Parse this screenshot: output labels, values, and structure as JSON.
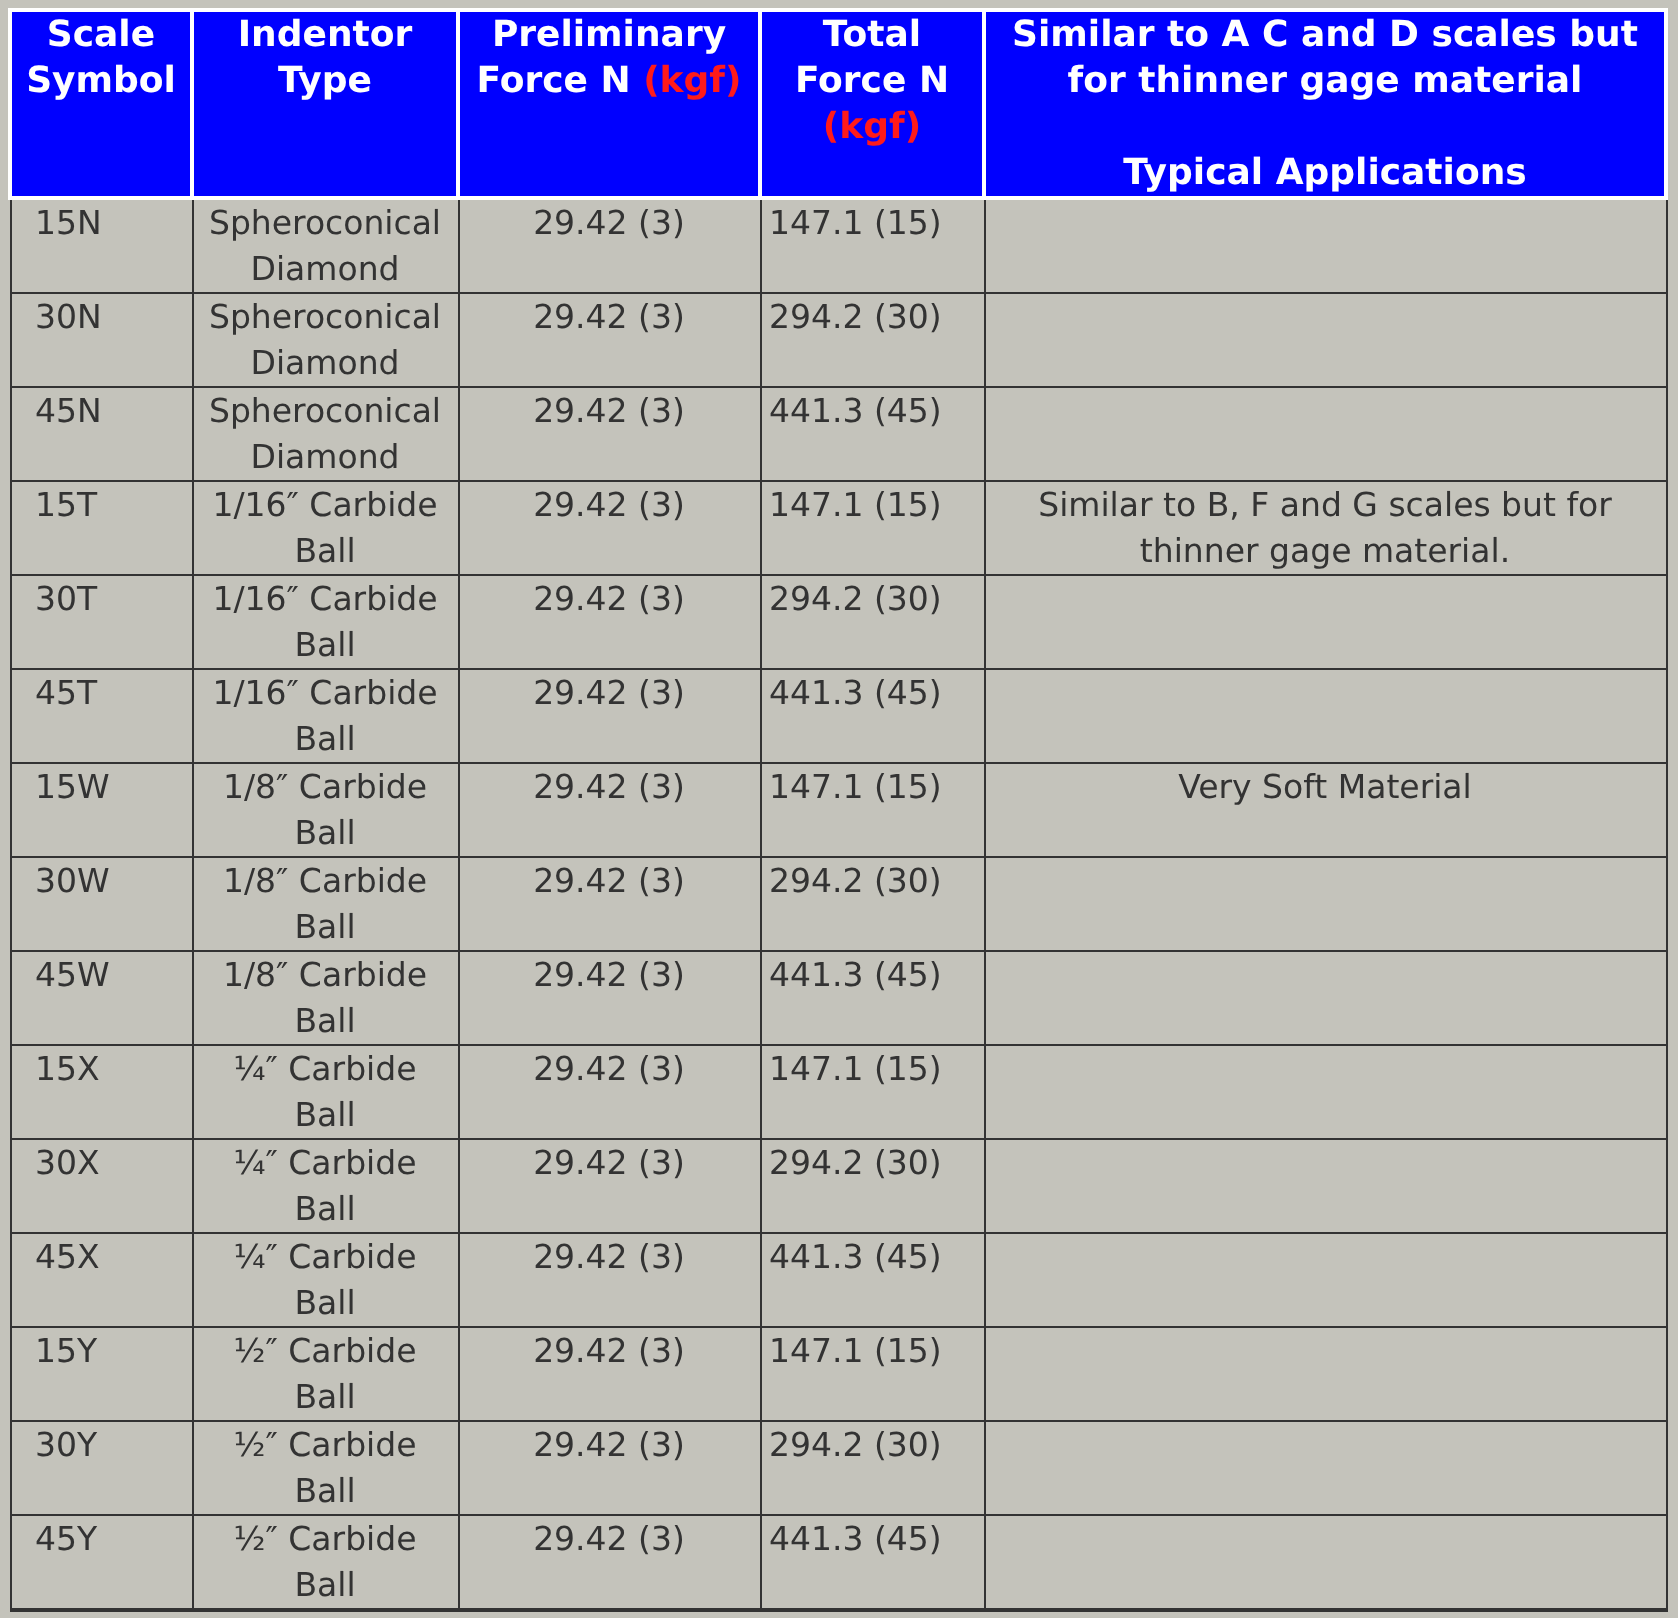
{
  "table": {
    "columns": [
      {
        "label": "Scale Symbol"
      },
      {
        "label": "Indentor Type"
      },
      {
        "label": "Preliminary Force N",
        "unit": "(kgf)"
      },
      {
        "label": "Total Force N",
        "unit": "(kgf)"
      },
      {
        "label": "Similar to A C and D scales but for thinner gage material",
        "sublabel": "Typical Applications"
      }
    ],
    "rows": [
      {
        "scale": "15N",
        "indentor": "Spheroconical Diamond",
        "preliminary": "29.42 (3)",
        "total": "147.1 (15)"
      },
      {
        "scale": "30N",
        "indentor": "Spheroconical Diamond",
        "preliminary": "29.42 (3)",
        "total": "294.2 (30)"
      },
      {
        "scale": "45N",
        "indentor": "Spheroconical Diamond",
        "preliminary": "29.42 (3)",
        "total": "441.3 (45)"
      },
      {
        "scale": "15T",
        "indentor": "1/16″ Carbide Ball",
        "preliminary": "29.42 (3)",
        "total": "147.1 (15)",
        "application": "Similar to B, F and G scales but for thinner gage material."
      },
      {
        "scale": "30T",
        "indentor": "1/16″ Carbide Ball",
        "preliminary": "29.42 (3)",
        "total": "294.2 (30)"
      },
      {
        "scale": "45T",
        "indentor": "1/16″ Carbide Ball",
        "preliminary": "29.42 (3)",
        "total": "441.3 (45)"
      },
      {
        "scale": "15W",
        "indentor": "1/8″ Carbide Ball",
        "preliminary": "29.42 (3)",
        "total": "147.1 (15)",
        "application": "Very Soft Material"
      },
      {
        "scale": "30W",
        "indentor": "1/8″ Carbide Ball",
        "preliminary": "29.42 (3)",
        "total": "294.2 (30)"
      },
      {
        "scale": "45W",
        "indentor": "1/8″ Carbide Ball",
        "preliminary": "29.42 (3)",
        "total": "441.3 (45)"
      },
      {
        "scale": "15X",
        "indentor": "¼″ Carbide Ball",
        "preliminary": "29.42 (3)",
        "total": "147.1 (15)"
      },
      {
        "scale": "30X",
        "indentor": "¼″ Carbide Ball",
        "preliminary": "29.42 (3)",
        "total": "294.2 (30)"
      },
      {
        "scale": "45X",
        "indentor": "¼″ Carbide Ball",
        "preliminary": "29.42 (3)",
        "total": "441.3 (45)"
      },
      {
        "scale": "15Y",
        "indentor": "½″ Carbide Ball",
        "preliminary": "29.42 (3)",
        "total": "147.1 (15)"
      },
      {
        "scale": "30Y",
        "indentor": "½″ Carbide Ball",
        "preliminary": "29.42 (3)",
        "total": "294.2 (30)"
      },
      {
        "scale": "45Y",
        "indentor": "½″ Carbide Ball",
        "preliminary": "29.42 (3)",
        "total": "441.3 (45)"
      }
    ]
  }
}
